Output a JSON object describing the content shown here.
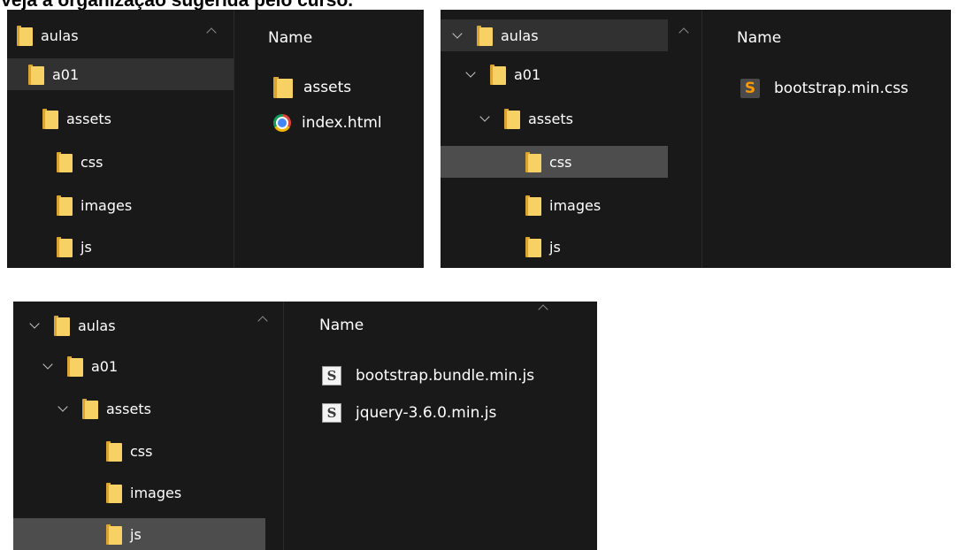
{
  "page_title": "Veja a organização sugerida pelo curso.",
  "panel_a": {
    "tree": [
      {
        "label": "aulas",
        "icon": "folder-icon"
      },
      {
        "label": "a01",
        "icon": "folder-icon"
      },
      {
        "label": "assets",
        "icon": "folder-icon"
      },
      {
        "label": "css",
        "icon": "folder-icon"
      },
      {
        "label": "images",
        "icon": "folder-icon"
      },
      {
        "label": "js",
        "icon": "folder-icon"
      }
    ],
    "column_header": "Name",
    "files": [
      {
        "name": "assets",
        "icon": "folder-icon"
      },
      {
        "name": "index.html",
        "icon": "chrome-icon"
      }
    ]
  },
  "panel_b": {
    "tree": [
      {
        "label": "aulas",
        "icon": "folder-icon"
      },
      {
        "label": "a01",
        "icon": "folder-icon"
      },
      {
        "label": "assets",
        "icon": "folder-icon"
      },
      {
        "label": "css",
        "icon": "folder-icon"
      },
      {
        "label": "images",
        "icon": "folder-icon"
      },
      {
        "label": "js",
        "icon": "folder-icon"
      }
    ],
    "column_header": "Name",
    "files": [
      {
        "name": "bootstrap.min.css",
        "icon": "sublime-text-icon"
      }
    ],
    "sublime_glyph": "S"
  },
  "panel_c": {
    "tree": [
      {
        "label": "aulas",
        "icon": "folder-icon"
      },
      {
        "label": "a01",
        "icon": "folder-icon"
      },
      {
        "label": "assets",
        "icon": "folder-icon"
      },
      {
        "label": "css",
        "icon": "folder-icon"
      },
      {
        "label": "images",
        "icon": "folder-icon"
      },
      {
        "label": "js",
        "icon": "folder-icon"
      }
    ],
    "column_header": "Name",
    "files": [
      {
        "name": "bootstrap.bundle.min.js",
        "icon": "script-file-icon"
      },
      {
        "name": "jquery-3.6.0.min.js",
        "icon": "script-file-icon"
      }
    ],
    "script_glyph": "S"
  },
  "colors": {
    "panel_background": "#191919",
    "selected_row": "#4d4d4d",
    "folder_yellow": "#f7d163",
    "sublime_orange": "#ff9800"
  }
}
